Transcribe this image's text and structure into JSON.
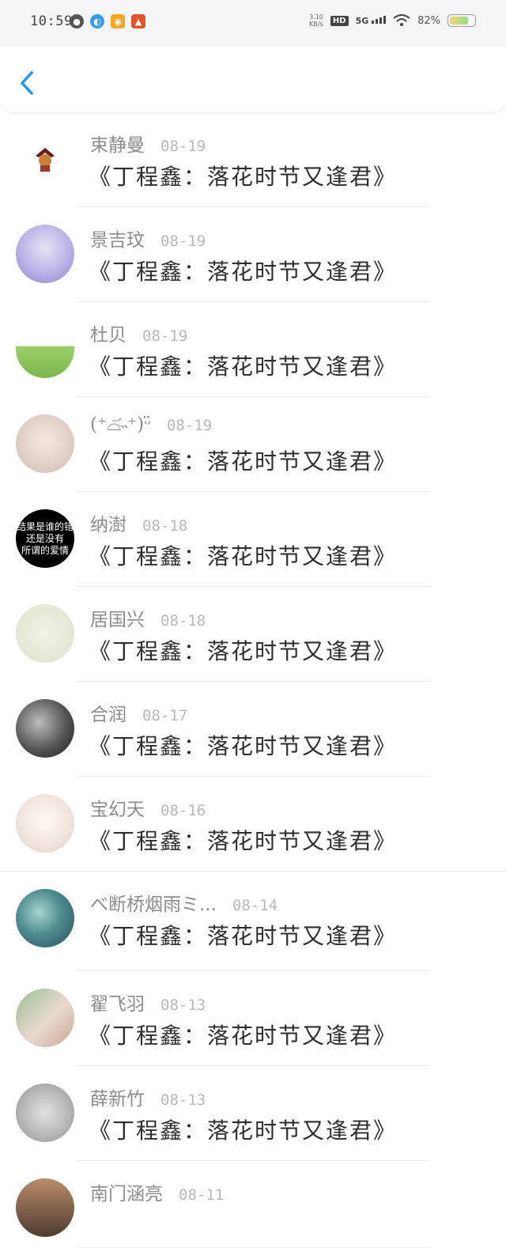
{
  "status_bar": {
    "time": "10:59",
    "net_speed_top": "3.10",
    "net_speed_bottom": "KB/s",
    "hd_label": "HD",
    "signal_label": "5G",
    "battery_text": "82%",
    "battery_level": 0.82,
    "icons": [
      "app-icon",
      "qq-icon",
      "weibo-icon",
      "notification-icon"
    ]
  },
  "nav": {
    "back_icon": "chevron-left-icon",
    "accent_color": "#2196f3"
  },
  "rows": [
    {
      "name": "束静曼",
      "date": "08-19",
      "message": "《丁程鑫：落花时节又逢君》"
    },
    {
      "name": "景吉玟",
      "date": "08-19",
      "message": "《丁程鑫：落花时节又逢君》"
    },
    {
      "name": "杜贝",
      "date": "08-19",
      "message": "《丁程鑫：落花时节又逢君》"
    },
    {
      "name": "(⁺⌓᷄˵⁺)ᵕ̈",
      "date": "08-19",
      "message": "《丁程鑫：落花时节又逢君》"
    },
    {
      "name": "纳澍",
      "date": "08-18",
      "message": "《丁程鑫：落花时节又逢君》",
      "avatar_text": "结果是谁的错\n还是没有\n所谓的爱情"
    },
    {
      "name": "居国兴",
      "date": "08-18",
      "message": "《丁程鑫：落花时节又逢君》"
    },
    {
      "name": "合润",
      "date": "08-17",
      "message": "《丁程鑫：落花时节又逢君》"
    },
    {
      "name": "宝幻天",
      "date": "08-16",
      "message": "《丁程鑫：落花时节又逢君》"
    },
    {
      "name": "べ断桥烟雨ミ...",
      "date": "08-14",
      "message": "《丁程鑫：落花时节又逢君》"
    },
    {
      "name": "翟飞羽",
      "date": "08-13",
      "message": "《丁程鑫：落花时节又逢君》"
    },
    {
      "name": "薛新竹",
      "date": "08-13",
      "message": "《丁程鑫：落花时节又逢君》"
    },
    {
      "name": "南门涵亮",
      "date": "08-11",
      "message": ""
    }
  ]
}
